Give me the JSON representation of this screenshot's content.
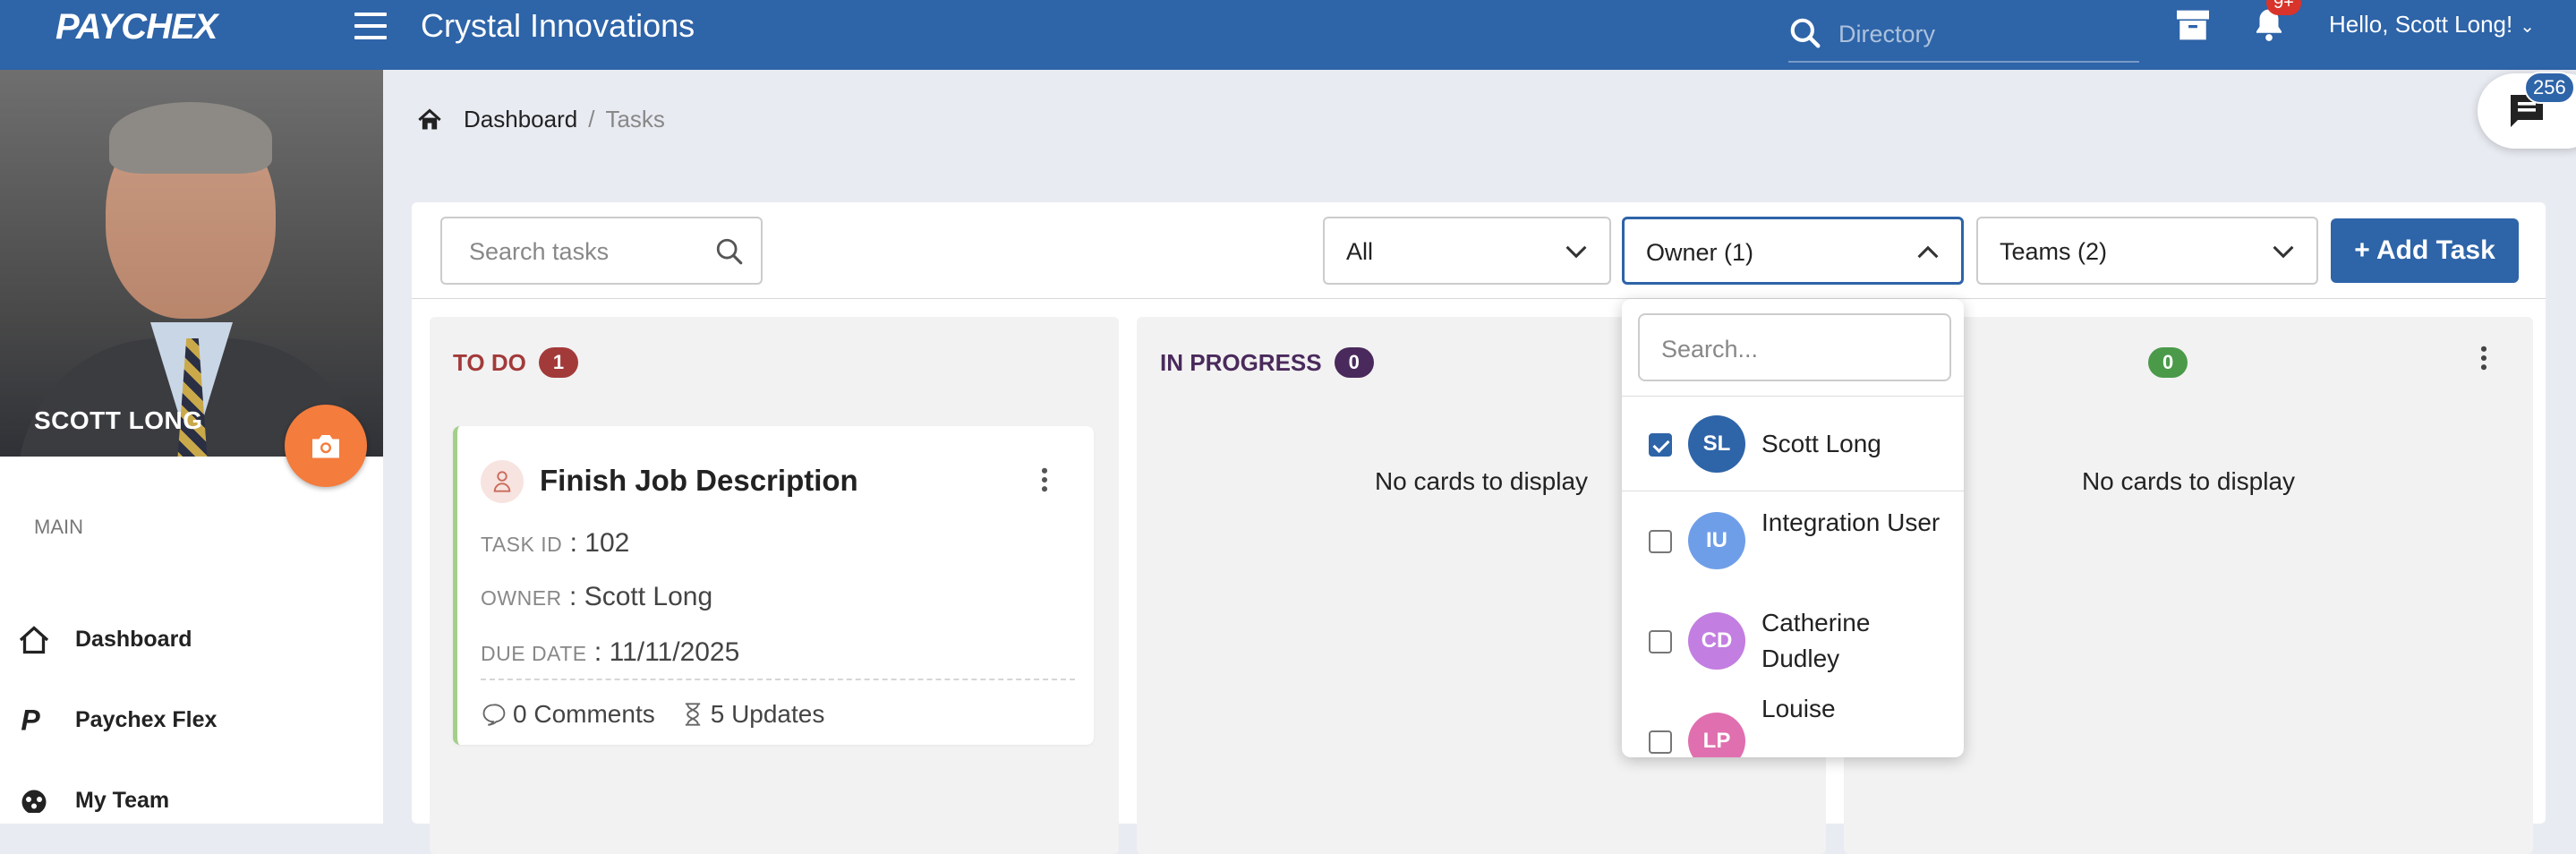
{
  "header": {
    "logo": "PAYCHEX",
    "company": "Crystal Innovations",
    "search_placeholder": "Directory",
    "notification_count": "9+",
    "greeting": "Hello, Scott Long!"
  },
  "chat": {
    "badge": "256"
  },
  "profile": {
    "name": "SCOTT LONG"
  },
  "sidebar": {
    "section": "MAIN",
    "items": [
      {
        "label": "Dashboard",
        "icon": "home-icon"
      },
      {
        "label": "Paychex Flex",
        "icon": "paychex-p-icon"
      },
      {
        "label": "My Team",
        "icon": "team-icon"
      }
    ]
  },
  "breadcrumb": {
    "root": "Dashboard",
    "sep": "/",
    "current": "Tasks"
  },
  "toolbar": {
    "search_placeholder": "Search tasks",
    "filter_status": "All",
    "filter_owner": "Owner (1)",
    "filter_teams": "Teams (2)",
    "add_label": "+ Add Task"
  },
  "columns": [
    {
      "title": "TO DO",
      "count": "1",
      "color": "#a33a3a",
      "badge_color": "#a33a3a"
    },
    {
      "title": "IN PROGRESS",
      "count": "0",
      "color": "#4a2a5c",
      "badge_color": "#4a2a5c",
      "empty": "No cards to display"
    },
    {
      "title": "",
      "count": "0",
      "badge_color": "#4a9a4a",
      "empty": "No cards to display"
    }
  ],
  "card": {
    "title": "Finish Job Description",
    "task_id_label": "TASK ID",
    "task_id": "102",
    "owner_label": "OWNER",
    "owner": "Scott Long",
    "due_label": "DUE DATE",
    "due": "11/11/2025",
    "comments": "0 Comments",
    "updates": "5 Updates"
  },
  "owner_dropdown": {
    "search_placeholder": "Search...",
    "options": [
      {
        "initials": "SL",
        "name": "Scott Long",
        "checked": true,
        "color": "#2e64a8"
      },
      {
        "initials": "IU",
        "name": "Integration User",
        "checked": false,
        "color": "#6f9ee8"
      },
      {
        "initials": "CD",
        "name": "Catherine Dudley",
        "checked": false,
        "color": "#c27ee0"
      },
      {
        "initials": "LP",
        "name": "Louise",
        "checked": false,
        "color": "#e06fb0"
      }
    ]
  }
}
